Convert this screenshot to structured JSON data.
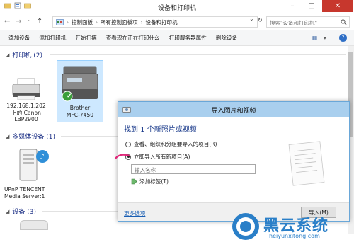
{
  "window": {
    "title": "设备和打印机"
  },
  "window_controls": {
    "minimize": "–",
    "maximize": "□",
    "close": "✕"
  },
  "nav": {
    "back": "←",
    "forward": "→",
    "recent": "⌄",
    "up": "↑"
  },
  "breadcrumb": {
    "items": [
      "控制面板",
      "所有控制面板项",
      "设备和打印机"
    ],
    "separator": "›",
    "dropdown": "⌄",
    "refresh": "↻"
  },
  "search": {
    "placeholder": "搜索\"设备和打印机\""
  },
  "toolbar": {
    "items": [
      "添加设备",
      "添加打印机",
      "开始扫描",
      "查看现在正在打印什么",
      "打印服务器属性",
      "删除设备"
    ],
    "view_glyph": "▦",
    "view_menu": "▾",
    "help": "?"
  },
  "sections": {
    "printers": {
      "title": "打印机 (2)",
      "chevron": "◢"
    },
    "media": {
      "title": "多媒体设备 (1)",
      "chevron": "◢"
    },
    "devices": {
      "title": "设备 (3)",
      "chevron": "◢"
    }
  },
  "devices": {
    "canon": {
      "line1": "192.168.1.202",
      "line2": "上的 Canon",
      "line3": "LBP2900"
    },
    "brother": {
      "line1": "Brother",
      "line2": "MFC-7450",
      "default_mark": "✔"
    },
    "upnp": {
      "line1": "UPnP TENCENT",
      "line2": "Media Server:1"
    }
  },
  "dialog": {
    "title": "导入图片和视频",
    "found": "找到 1 个新照片或视频",
    "option1": "查看、组织和分组要导入的项目(R)",
    "option2": "立即导入所有新项目(A)",
    "name_placeholder": "输入名称",
    "add_tags": "添加标签(T)",
    "more_options": "更多选项",
    "import_button": "导入(M)"
  },
  "watermark": {
    "name": "黑云系统",
    "url": "heiyunxitong.com"
  },
  "colors": {
    "accent": "#1e3287",
    "dialog_title": "#a9cfee",
    "close": "#c7372d",
    "brand": "#2a7fc8"
  }
}
